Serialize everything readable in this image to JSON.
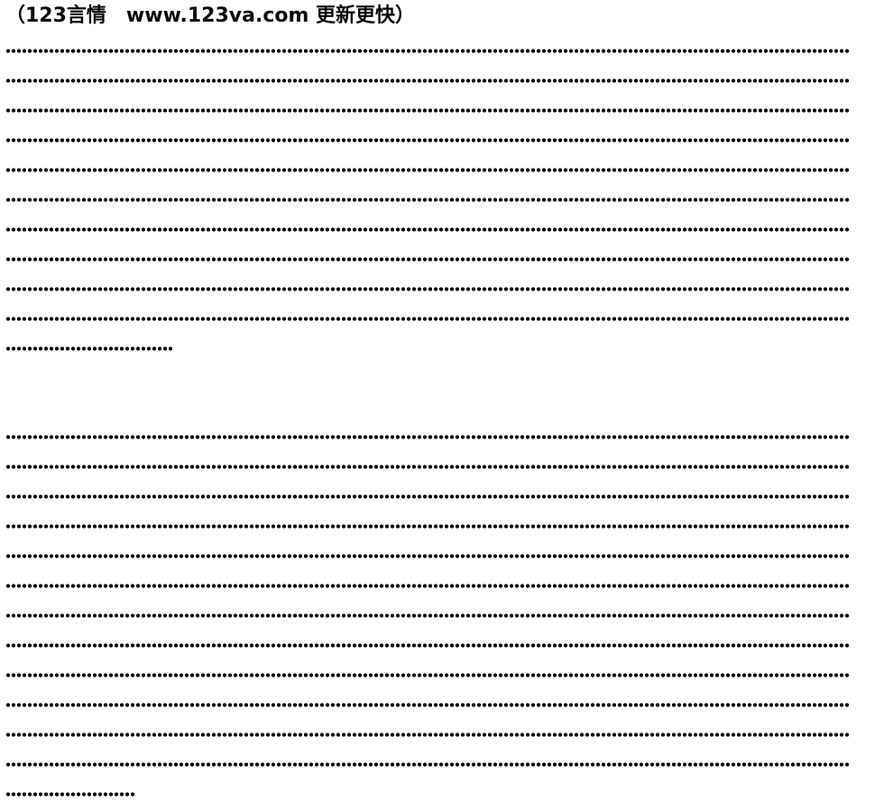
{
  "header": {
    "text": "（123言情　www.123va.com 更新更快）"
  },
  "paragraphs": [
    {
      "lines": [
        1,
        1,
        1,
        1,
        1,
        1,
        1,
        1,
        1,
        1,
        0.2
      ]
    },
    {
      "lines": [
        1,
        1,
        1,
        1,
        1,
        1,
        1,
        1,
        1,
        1,
        1,
        1,
        0.15
      ]
    }
  ],
  "colors": {
    "text": "#0a0a0a",
    "dots": "#000000",
    "background": "#ffffff"
  }
}
